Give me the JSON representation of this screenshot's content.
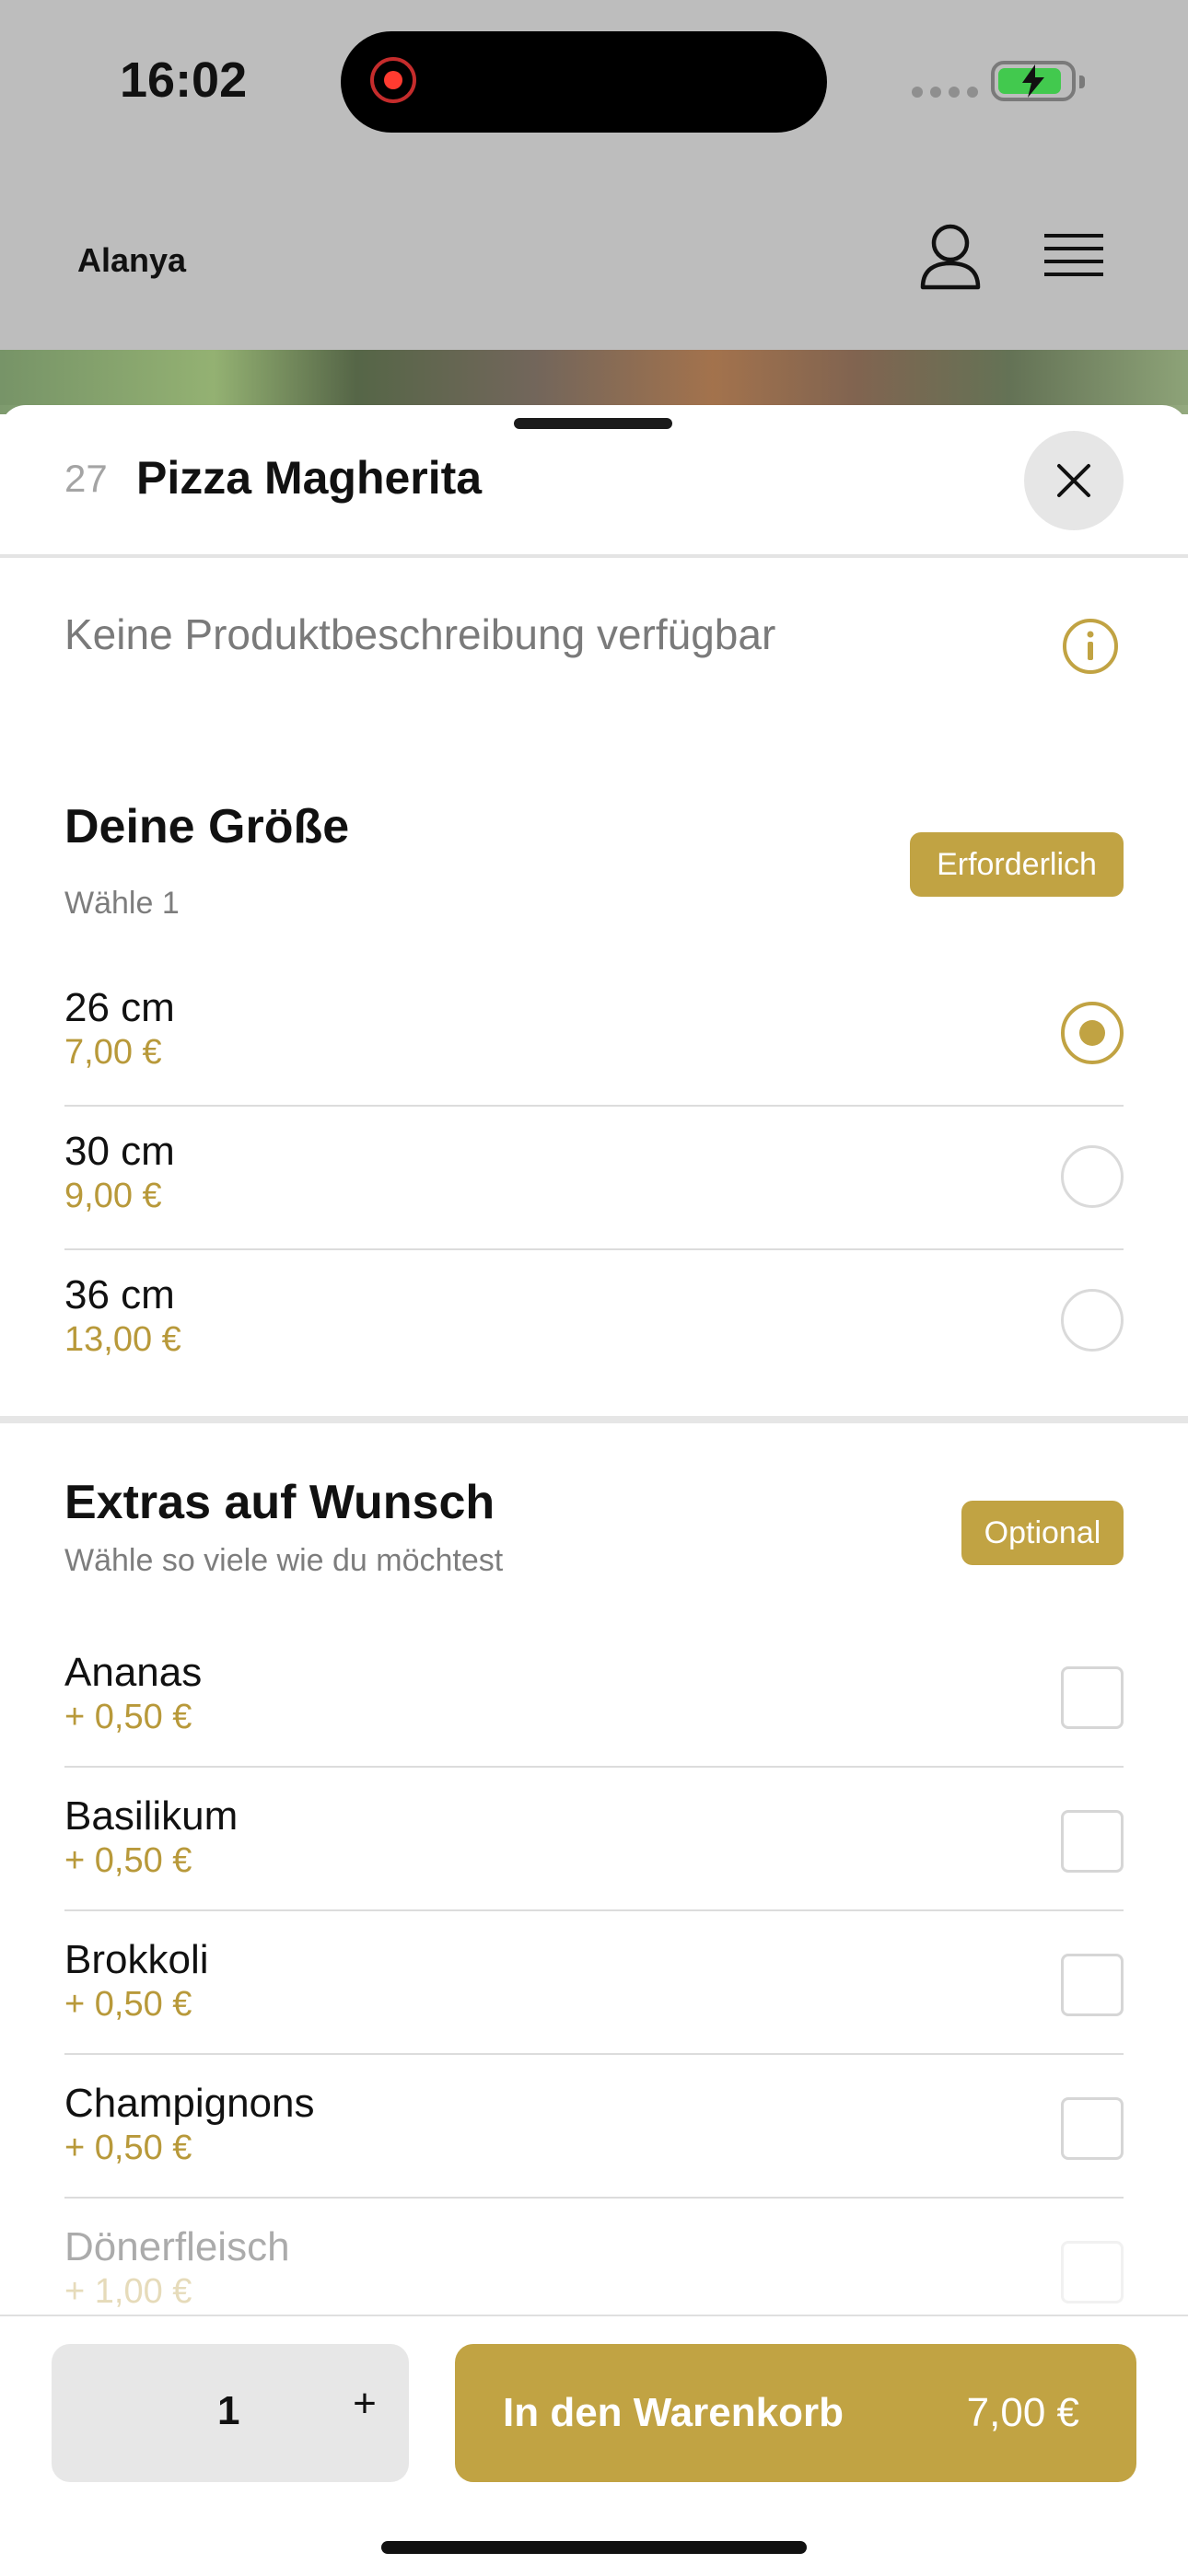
{
  "status_bar": {
    "time": "16:02"
  },
  "header": {
    "location": "Alanya"
  },
  "product": {
    "number": "27",
    "title": "Pizza Magherita",
    "description": "Keine Produktbeschreibung verfügbar"
  },
  "size_section": {
    "title": "Deine Größe",
    "subtitle": "Wähle 1",
    "badge": "Erforderlich",
    "options": [
      {
        "name": "26 cm",
        "price": "7,00 €",
        "selected": true
      },
      {
        "name": "30 cm",
        "price": "9,00 €",
        "selected": false
      },
      {
        "name": "36 cm",
        "price": "13,00 €",
        "selected": false
      }
    ]
  },
  "extras_section": {
    "title": "Extras auf Wunsch",
    "subtitle": "Wähle so viele wie du möchtest",
    "badge": "Optional",
    "options": [
      {
        "name": "Ananas",
        "price": "+ 0,50 €",
        "checked": false
      },
      {
        "name": "Basilikum",
        "price": "+ 0,50 €",
        "checked": false
      },
      {
        "name": "Brokkoli",
        "price": "+ 0,50 €",
        "checked": false
      },
      {
        "name": "Champignons",
        "price": "+ 0,50 €",
        "checked": false
      },
      {
        "name": "Dönerfleisch",
        "price": "+ 1,00 €",
        "checked": false
      }
    ]
  },
  "bottom_bar": {
    "quantity": "1",
    "plus_label": "+",
    "add_to_cart_label": "In den Warenkorb",
    "total": "7,00 €"
  },
  "colors": {
    "accent": "#c1a343",
    "text": "#111111",
    "muted": "#7a7a7a"
  }
}
